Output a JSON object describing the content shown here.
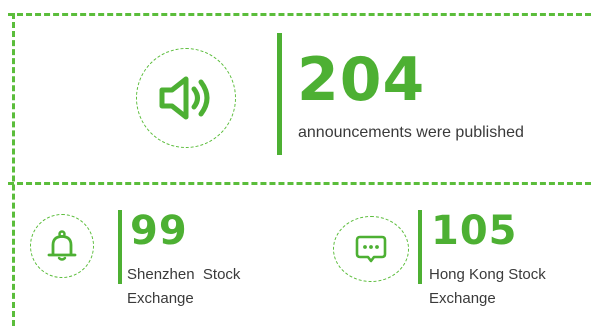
{
  "colors": {
    "accent": "#4db033",
    "dash": "#5bbd3b",
    "text": "#3a3a3a"
  },
  "total": {
    "icon": "speaker-icon",
    "number": "204",
    "label": "announcements were published"
  },
  "exchanges": [
    {
      "icon": "bell-icon",
      "number": "99",
      "label_line1": "Shenzhen  Stock",
      "label_line2": "Exchange"
    },
    {
      "icon": "chat-bubble-icon",
      "number": "105",
      "label_line1": "Hong Kong Stock",
      "label_line2": "Exchange"
    }
  ]
}
